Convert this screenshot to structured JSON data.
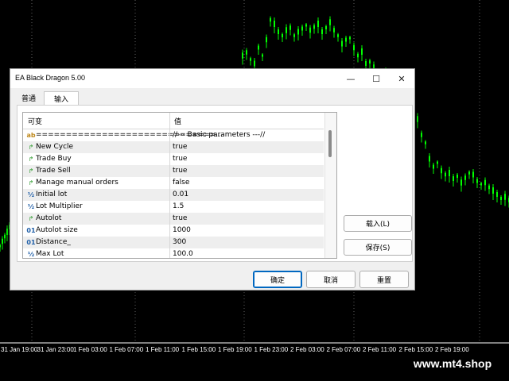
{
  "chart": {
    "time_labels": [
      "31 Jan 19:00",
      "31 Jan 23:00",
      "1 Feb 03:00",
      "1 Feb 07:00",
      "1 Feb 11:00",
      "1 Feb 15:00",
      "1 Feb 19:00",
      "1 Feb 23:00",
      "2 Feb 03:00",
      "2 Feb 07:00",
      "2 Feb 11:00",
      "2 Feb 15:00",
      "2 Feb 19:00"
    ],
    "candle_color": "#00ff00",
    "grid_color": "#606060",
    "background": "#000000"
  },
  "watermark": "www.mt4.shop",
  "dialog": {
    "title": "EA Black Dragon 5.00",
    "window_buttons": {
      "minimize": "—",
      "maximize": "☐",
      "close": "✕"
    },
    "tabs": [
      {
        "label": "普通",
        "active": false
      },
      {
        "label": "输入",
        "active": true
      }
    ],
    "columns": {
      "variable": "可变",
      "value": "值"
    },
    "rows": [
      {
        "icon": "ab-icon",
        "glyph": "ab",
        "name": "==============================...",
        "value": "//--- Basic parameters ---//"
      },
      {
        "icon": "bool-arrow-icon",
        "glyph": "↱",
        "name": "New Cycle",
        "value": "true"
      },
      {
        "icon": "bool-arrow-icon",
        "glyph": "↱",
        "name": "Trade Buy",
        "value": "true"
      },
      {
        "icon": "bool-arrow-icon",
        "glyph": "↱",
        "name": "Trade Sell",
        "value": "true"
      },
      {
        "icon": "bool-arrow-icon",
        "glyph": "↱",
        "name": "Manage manual orders",
        "value": "false"
      },
      {
        "icon": "double-icon",
        "glyph": "½",
        "name": "Initial lot",
        "value": "0.01"
      },
      {
        "icon": "double-icon",
        "glyph": "½",
        "name": "Lot Multiplier",
        "value": "1.5"
      },
      {
        "icon": "bool-arrow-icon",
        "glyph": "↱",
        "name": "Autolot",
        "value": "true"
      },
      {
        "icon": "int-icon",
        "glyph": "01",
        "name": "Autolot size",
        "value": "1000"
      },
      {
        "icon": "int-icon",
        "glyph": "01",
        "name": "Distance_",
        "value": "300"
      },
      {
        "icon": "double-icon",
        "glyph": "½",
        "name": "Max Lot",
        "value": "100.0"
      }
    ],
    "load_button": "载入(L)",
    "save_button": "保存(S)",
    "ok_button": "确定",
    "cancel_button": "取消",
    "reset_button": "重置"
  }
}
